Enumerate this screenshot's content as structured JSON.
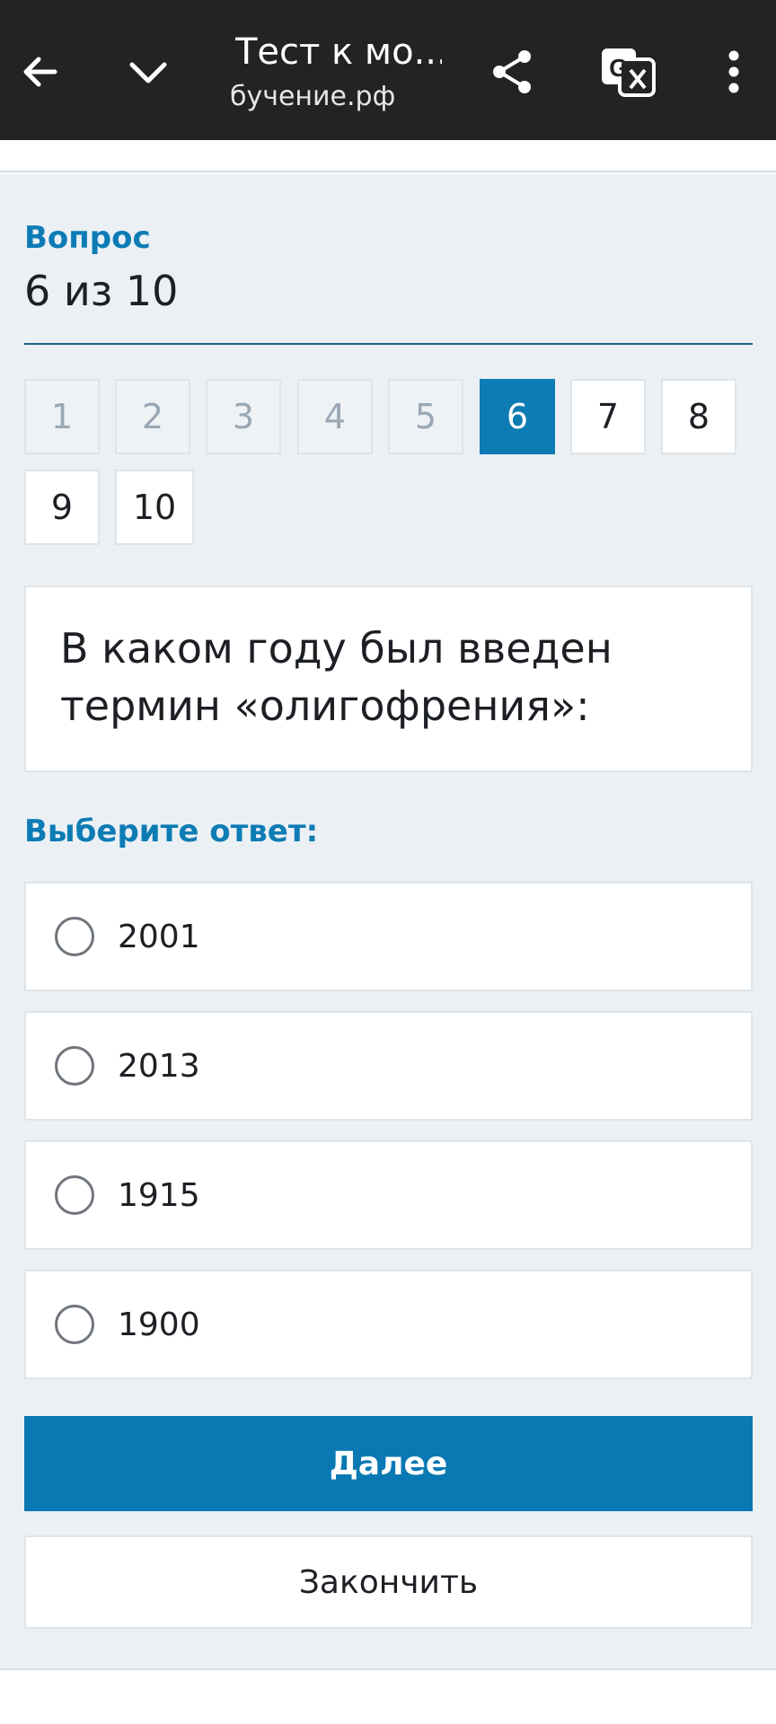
{
  "browser": {
    "title": "Тест к мо...",
    "url": "бучение.рф",
    "icons": [
      "back-arrow-icon",
      "chevron-down-icon",
      "share-icon",
      "translate-icon",
      "more-vertical-icon"
    ]
  },
  "quiz": {
    "question_label": "Вопрос",
    "question_count": "6 из 10",
    "nav": [
      {
        "label": "1",
        "state": "done"
      },
      {
        "label": "2",
        "state": "done"
      },
      {
        "label": "3",
        "state": "done"
      },
      {
        "label": "4",
        "state": "done"
      },
      {
        "label": "5",
        "state": "done"
      },
      {
        "label": "6",
        "state": "current"
      },
      {
        "label": "7",
        "state": "todo"
      },
      {
        "label": "8",
        "state": "todo"
      },
      {
        "label": "9",
        "state": "todo"
      },
      {
        "label": "10",
        "state": "todo"
      }
    ],
    "question_text": "В каком году был введен термин «олигофрения»:",
    "choose_label": "Выберите ответ:",
    "options": [
      "2001",
      "2013",
      "1915",
      "1900"
    ],
    "next_label": "Далее",
    "finish_label": "Закончить"
  },
  "colors": {
    "accent": "#0d7cb5",
    "topbar": "#222324",
    "background": "#ebf0f4"
  }
}
